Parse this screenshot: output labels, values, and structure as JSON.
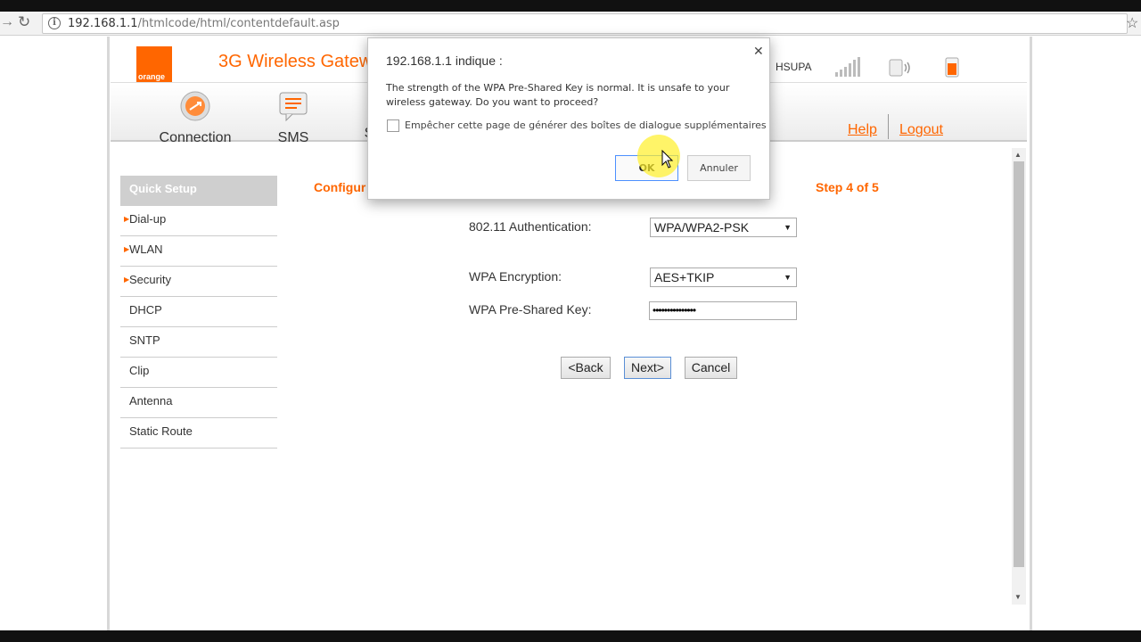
{
  "browser": {
    "url_host": "192.168.1.1",
    "url_path": "/htmlcode/html/contentdefault.asp"
  },
  "header": {
    "logo_text": "orange",
    "title": "3G Wireless Gatew",
    "network_type": "HSUPA"
  },
  "menu": {
    "items": [
      {
        "label": "Connection",
        "icon": "connection-icon"
      },
      {
        "label": "SMS",
        "icon": "sms-icon"
      },
      {
        "label": "S",
        "icon": "settings-icon"
      }
    ],
    "help": "Help",
    "logout": "Logout"
  },
  "sidebar": {
    "items": [
      {
        "label": "Quick Setup",
        "active": true
      },
      {
        "label": "Dial-up",
        "arrow": true
      },
      {
        "label": "WLAN",
        "arrow": true
      },
      {
        "label": "Security",
        "arrow": true
      },
      {
        "label": "DHCP"
      },
      {
        "label": "SNTP"
      },
      {
        "label": "Clip"
      },
      {
        "label": "Antenna"
      },
      {
        "label": "Static Route"
      }
    ]
  },
  "content": {
    "heading": "Configur",
    "step": "Step 4 of 5",
    "auth_label": "802.11 Authentication:",
    "auth_value": "WPA/WPA2-PSK",
    "enc_label": "WPA Encryption:",
    "enc_value": "AES+TKIP",
    "psk_label": "WPA Pre-Shared Key:",
    "psk_value": "•••••••••••••••",
    "back": "<Back",
    "next": "Next>",
    "cancel": "Cancel"
  },
  "dialog": {
    "title": "192.168.1.1 indique :",
    "message": "The strength of the WPA Pre-Shared Key is normal. It is unsafe to your wireless gateway. Do you want to proceed?",
    "checkbox_label": "Empêcher cette page de générer des boîtes de dialogue supplémentaires",
    "ok": "OK",
    "cancel": "Annuler"
  },
  "colors": {
    "brand": "#ff6600",
    "focus": "#4d90fe"
  }
}
